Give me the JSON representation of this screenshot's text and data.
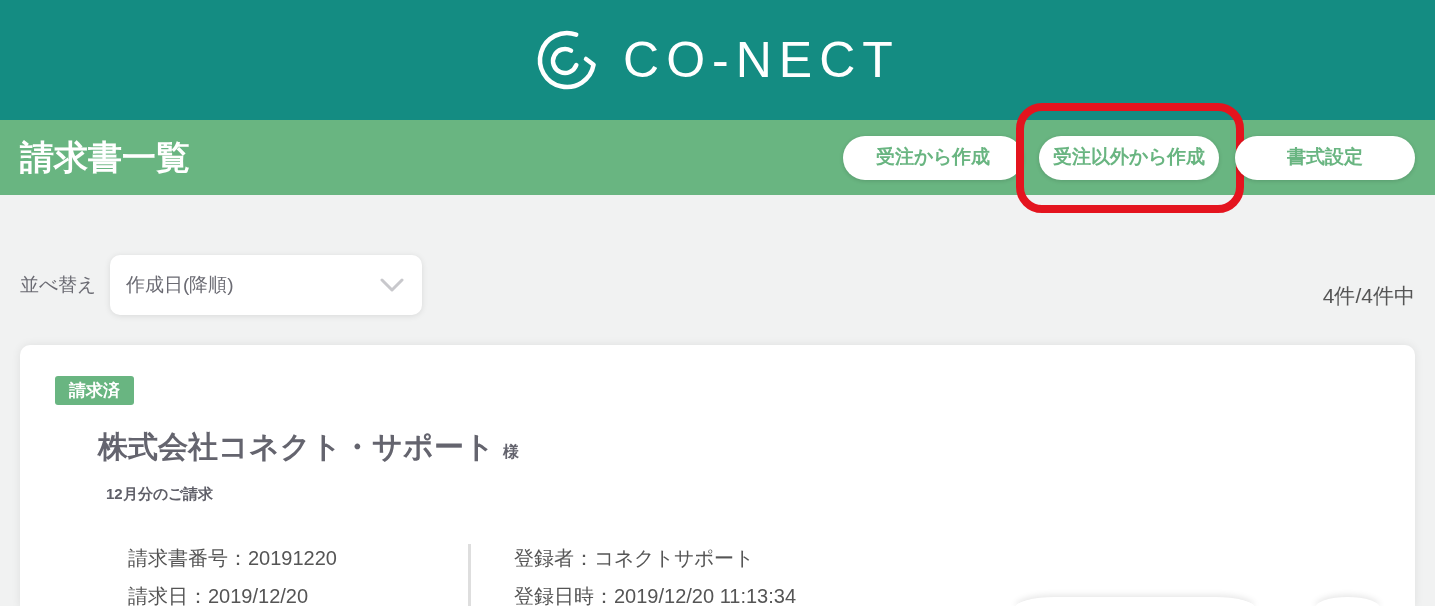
{
  "header": {
    "logo_text": "CO-NECT"
  },
  "page_bar": {
    "title": "請求書一覧",
    "buttons": [
      {
        "label": "受注から作成",
        "highlighted": false
      },
      {
        "label": "受注以外から作成",
        "highlighted": true
      },
      {
        "label": "書式設定",
        "highlighted": false
      }
    ]
  },
  "sort": {
    "label": "並べ替え",
    "value": "作成日(降順)"
  },
  "result_count": "4件/4件中",
  "invoices": [
    {
      "status": "請求済",
      "company": "株式会社コネクト・サポート",
      "honorific": "様",
      "period": "12月分のご請求",
      "details_left": [
        "請求書番号：20191220",
        "請求日：2019/12/20"
      ],
      "details_right": [
        "登録者：コネクトサポート",
        "登録日時：2019/12/20 11:13:34"
      ]
    }
  ]
}
